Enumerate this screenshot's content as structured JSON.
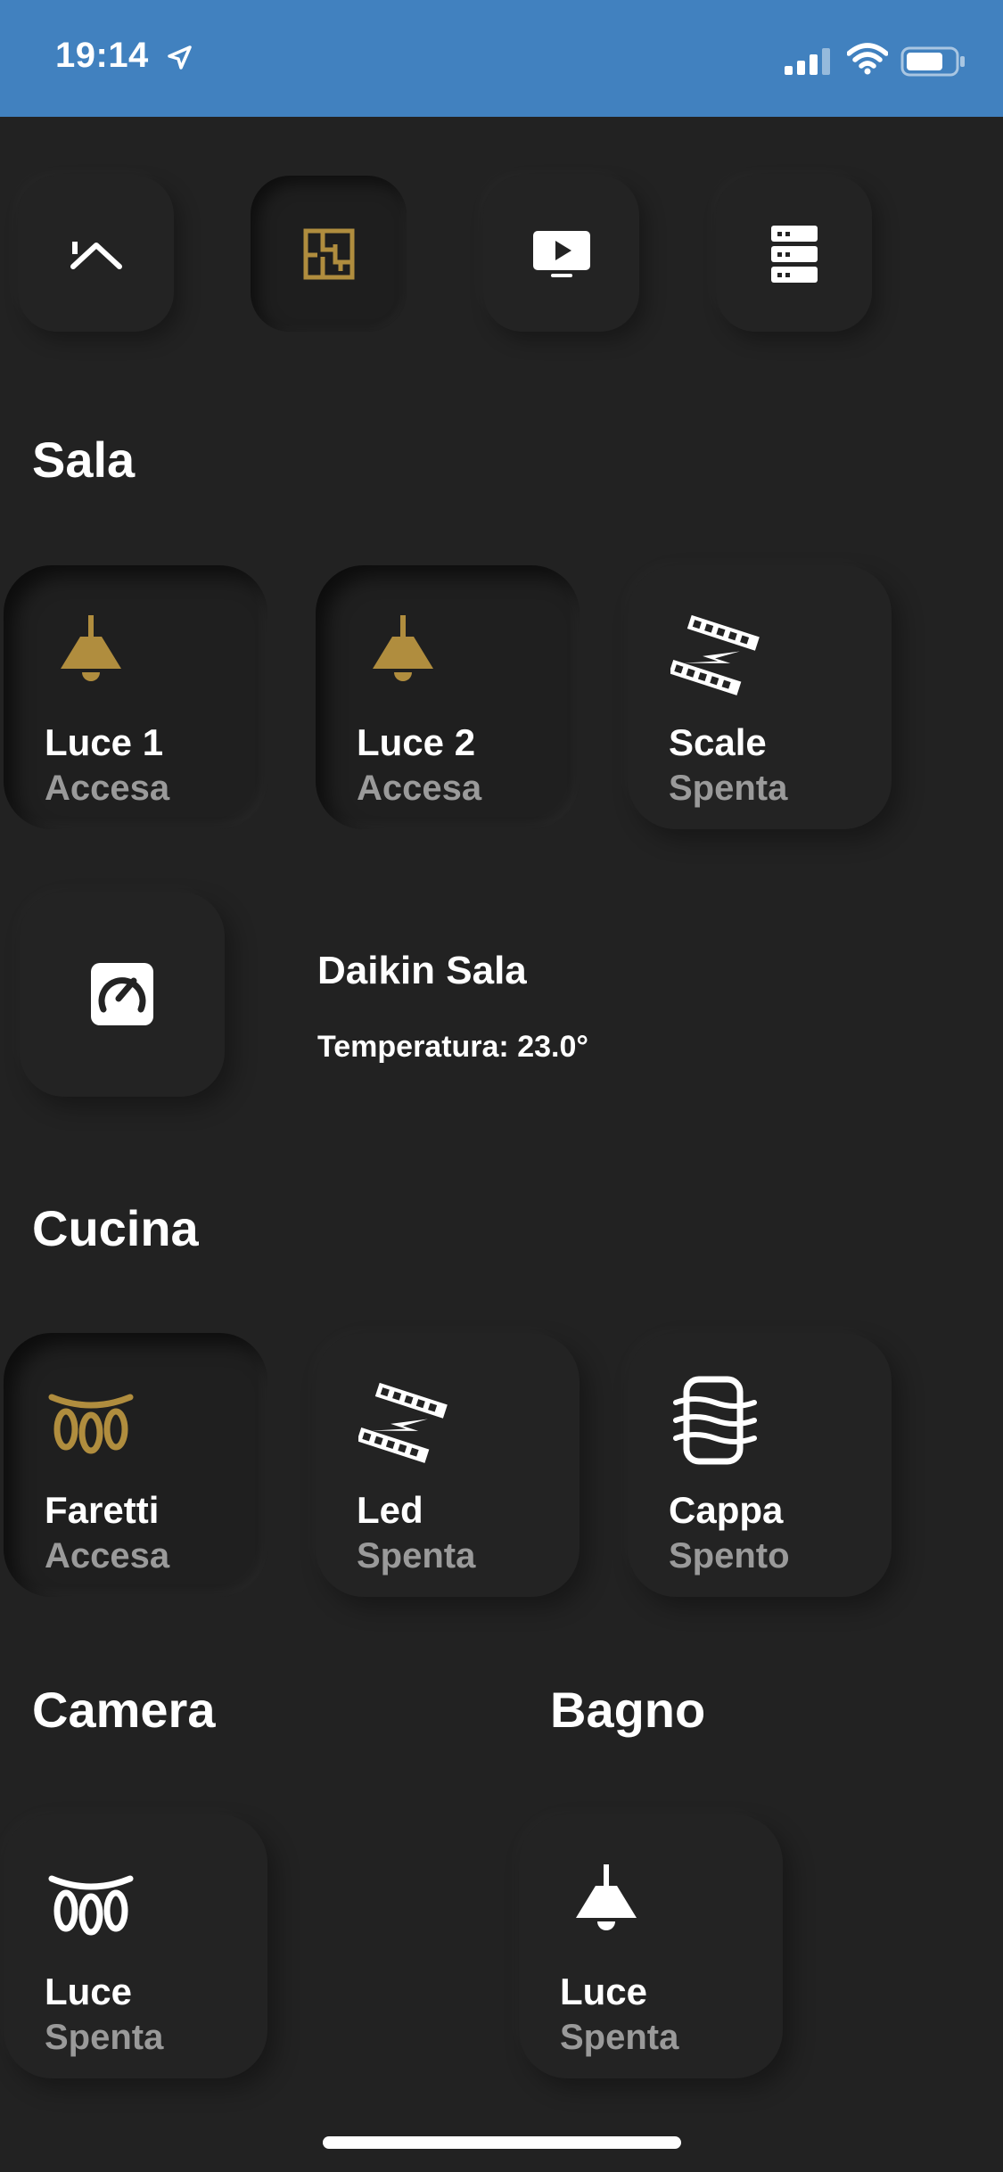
{
  "status_bar": {
    "time": "19:14"
  },
  "nav": [
    {
      "name": "home-icon",
      "active": false
    },
    {
      "name": "floorplan-icon",
      "active": true
    },
    {
      "name": "tv-icon",
      "active": false
    },
    {
      "name": "server-icon",
      "active": false
    }
  ],
  "sections": {
    "sala": {
      "title": "Sala",
      "tiles": [
        {
          "name": "Luce 1",
          "state": "Accesa",
          "icon": "ceiling-lamp-icon",
          "on": true
        },
        {
          "name": "Luce 2",
          "state": "Accesa",
          "icon": "ceiling-lamp-icon",
          "on": true
        },
        {
          "name": "Scale",
          "state": "Spenta",
          "icon": "led-strip-icon",
          "on": false
        }
      ],
      "climate": {
        "name": "Daikin Sala",
        "temperature": "Temperatura: 23.0°",
        "icon": "thermostat-icon"
      }
    },
    "cucina": {
      "title": "Cucina",
      "tiles": [
        {
          "name": "Faretti",
          "state": "Accesa",
          "icon": "spotlights-icon",
          "on": true
        },
        {
          "name": "Led",
          "state": "Spenta",
          "icon": "led-strip-icon",
          "on": false
        },
        {
          "name": "Cappa",
          "state": "Spento",
          "icon": "range-hood-icon",
          "on": false
        }
      ]
    },
    "camera": {
      "title": "Camera",
      "tiles": [
        {
          "name": "Luce",
          "state": "Spenta",
          "icon": "spotlights-icon",
          "on": false
        }
      ]
    },
    "bagno": {
      "title": "Bagno",
      "tiles": [
        {
          "name": "Luce",
          "state": "Spenta",
          "icon": "ceiling-lamp-icon",
          "on": false
        }
      ]
    }
  },
  "colors": {
    "accent": "#b08d3e",
    "status_bar": "#4181bf",
    "background": "#222222",
    "state_text": "#9a9a9a"
  }
}
